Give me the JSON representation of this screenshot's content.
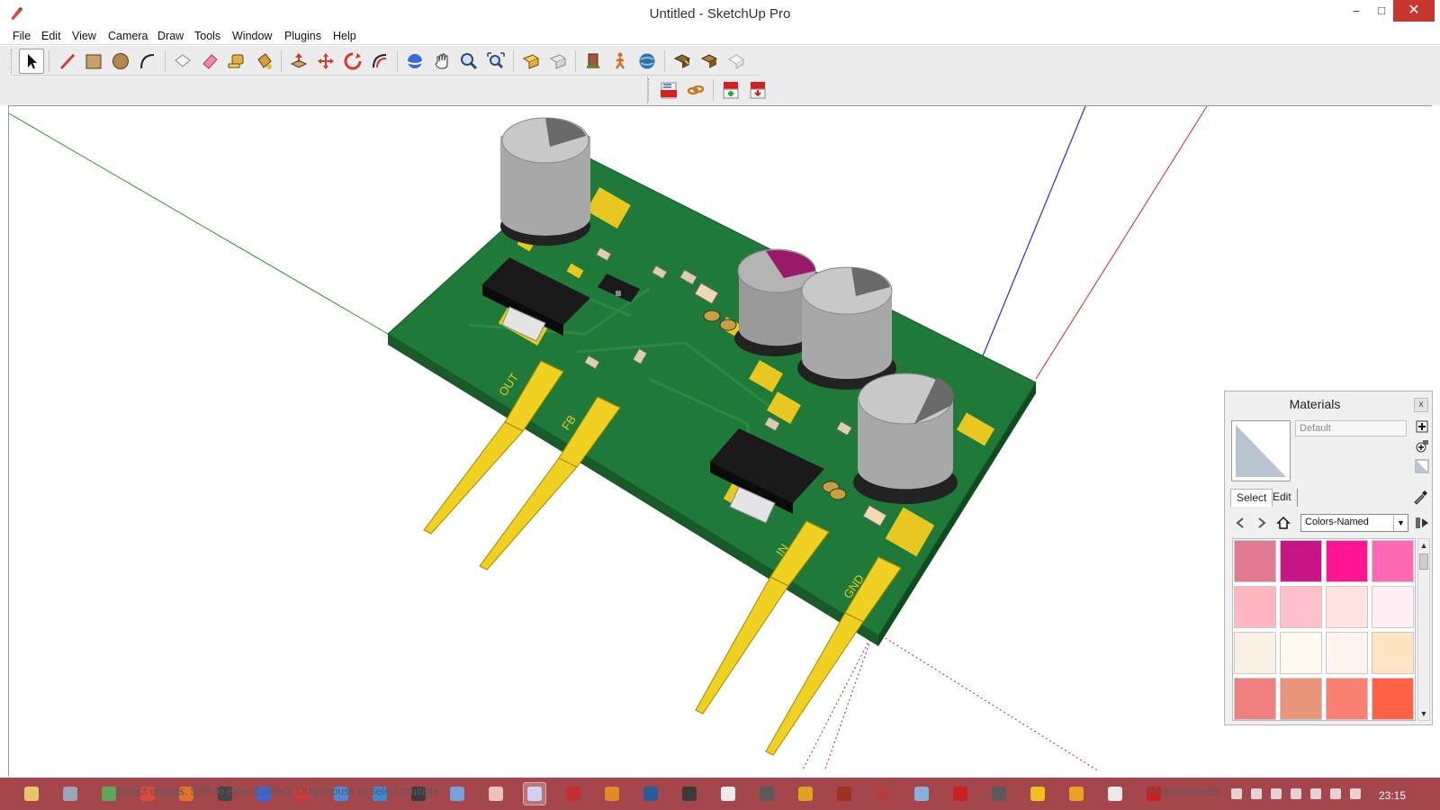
{
  "window": {
    "title": "Untitled - SketchUp Pro",
    "minimize_glyph": "–",
    "maximize_glyph": "□",
    "close_glyph": "✕"
  },
  "menu": [
    "File",
    "Edit",
    "View",
    "Camera",
    "Draw",
    "Tools",
    "Window",
    "Plugins",
    "Help"
  ],
  "toolbar_main": [
    {
      "icon": "select-arrow-icon",
      "active": true
    },
    {
      "icon": "pencil-line-icon"
    },
    {
      "icon": "rectangle-icon"
    },
    {
      "icon": "circle-icon"
    },
    {
      "icon": "arc-icon"
    },
    {
      "icon": "make-component-icon"
    },
    {
      "icon": "eraser-icon"
    },
    {
      "icon": "tape-measure-icon"
    },
    {
      "icon": "paint-bucket-icon"
    },
    {
      "icon": "push-pull-icon"
    },
    {
      "icon": "move-icon"
    },
    {
      "icon": "rotate-icon"
    },
    {
      "icon": "offset-icon"
    },
    {
      "icon": "orbit-icon"
    },
    {
      "icon": "pan-icon"
    },
    {
      "icon": "zoom-icon"
    },
    {
      "icon": "zoom-extents-icon"
    },
    {
      "icon": "previous-view-icon"
    },
    {
      "icon": "next-view-icon"
    },
    {
      "icon": "position-camera-icon"
    },
    {
      "icon": "walk-icon"
    },
    {
      "icon": "get-location-icon"
    },
    {
      "icon": "share-model-icon"
    },
    {
      "icon": "get-models-icon"
    },
    {
      "icon": "extension-icon"
    }
  ],
  "toolbar_plugins": [
    {
      "icon": "export-pdf-icon"
    },
    {
      "icon": "chain-link-icon"
    },
    {
      "icon": "pdf-import-icon"
    },
    {
      "icon": "pdf-html-icon"
    }
  ],
  "viewport": {
    "pin_labels": [
      "OUT",
      "FB",
      "IN",
      "GND"
    ]
  },
  "materials": {
    "title": "Materials",
    "close_glyph": "x",
    "name_placeholder": "Default",
    "tabs": [
      "Select",
      "Edit"
    ],
    "library": "Colors-Named",
    "swatches": [
      "#e07a90",
      "#c71585",
      "#ff1493",
      "#ff69b4",
      "#ffb6c1",
      "#ffc0cb",
      "#ffe4e1",
      "#fff0f5",
      "#faf0e6",
      "#fffaf0",
      "#fff5ee",
      "#ffe4c4",
      "#f08080",
      "#e9967a",
      "#fa8072",
      "#ff6347"
    ]
  },
  "status": {
    "hint": "Select objects. Shift to extend select. Drag mouse to select multiple.",
    "measurements_label": "Measurements",
    "clock": "23:15"
  },
  "taskbar": {
    "apps": [
      "#e8c46a",
      "#9aa7b6",
      "#5aa85a",
      "#d84a3a",
      "#e0702a",
      "#444444",
      "#3a66d8",
      "#cc3a3a",
      "#4a8ad8",
      "#3a8ad8",
      "#3a3a3a",
      "#7aa0d8",
      "#f0c0c0",
      "#d0d0f0",
      "#c03030",
      "#e08a2a",
      "#2a5a9a",
      "#3a3a3a",
      "#eaeaea",
      "#5a5a5a",
      "#e0a020",
      "#a03020",
      "#b04040",
      "#8ab0d8",
      "#cc2020",
      "#5a5a5a",
      "#f0c020",
      "#f0a020",
      "#eaeaea",
      "#cc2020"
    ]
  }
}
